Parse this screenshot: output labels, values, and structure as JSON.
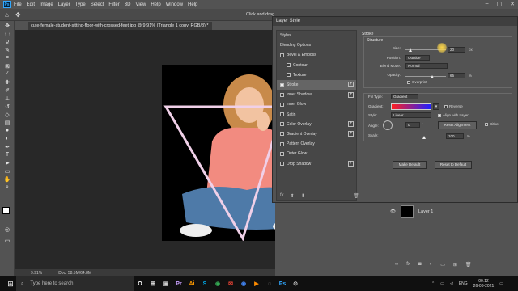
{
  "menubar": {
    "logo": "Ps",
    "items": [
      "File",
      "Edit",
      "Image",
      "Layer",
      "Type",
      "Select",
      "Filter",
      "3D",
      "View",
      "Help",
      "Window",
      "Help"
    ],
    "window_controls": [
      "–",
      "▢",
      "✕"
    ]
  },
  "optionsbar": {
    "hint": "Click and drag..."
  },
  "document": {
    "tab": "cute-female-student-sitting-floor-with-crossed-feet.jpg @ 9.91% (Triangle 1 copy, RGB/8) *",
    "zoom": "9.91%",
    "doc_info": "Doc: 58.5M/64.8M"
  },
  "dialog": {
    "title": "Layer Style",
    "styles_header": "Styles",
    "styles": [
      {
        "label": "Blending Options",
        "checkbox": false,
        "checked": false,
        "plus": false,
        "indent": false,
        "selected": false
      },
      {
        "label": "Bevel & Emboss",
        "checkbox": true,
        "checked": false,
        "plus": false,
        "indent": false,
        "selected": false
      },
      {
        "label": "Contour",
        "checkbox": true,
        "checked": false,
        "plus": false,
        "indent": true,
        "selected": false
      },
      {
        "label": "Texture",
        "checkbox": true,
        "checked": false,
        "plus": false,
        "indent": true,
        "selected": false
      },
      {
        "label": "Stroke",
        "checkbox": true,
        "checked": true,
        "plus": true,
        "indent": false,
        "selected": true
      },
      {
        "label": "Inner Shadow",
        "checkbox": true,
        "checked": false,
        "plus": true,
        "indent": false,
        "selected": false
      },
      {
        "label": "Inner Glow",
        "checkbox": true,
        "checked": false,
        "plus": false,
        "indent": false,
        "selected": false
      },
      {
        "label": "Satin",
        "checkbox": true,
        "checked": false,
        "plus": false,
        "indent": false,
        "selected": false
      },
      {
        "label": "Color Overlay",
        "checkbox": true,
        "checked": false,
        "plus": true,
        "indent": false,
        "selected": false
      },
      {
        "label": "Gradient Overlay",
        "checkbox": true,
        "checked": false,
        "plus": true,
        "indent": false,
        "selected": false
      },
      {
        "label": "Pattern Overlay",
        "checkbox": true,
        "checked": false,
        "plus": false,
        "indent": false,
        "selected": false
      },
      {
        "label": "Outer Glow",
        "checkbox": true,
        "checked": false,
        "plus": false,
        "indent": false,
        "selected": false
      },
      {
        "label": "Drop Shadow",
        "checkbox": true,
        "checked": false,
        "plus": true,
        "indent": false,
        "selected": false
      }
    ],
    "footer": {
      "fx": "fx",
      "up": "⬆",
      "down": "⬇",
      "trash": "🗑"
    },
    "stroke": {
      "heading": "Stroke",
      "structure": "Structure",
      "size_label": "Size:",
      "size_value": "20",
      "size_unit": "px",
      "position_label": "Position:",
      "position_value": "Outside",
      "blend_label": "Blend Mode:",
      "blend_value": "Normal",
      "opacity_label": "Opacity:",
      "opacity_value": "65",
      "opacity_unit": "%",
      "overprint": "Overprint",
      "fill_type_label": "Fill Type:",
      "fill_type_value": "Gradient",
      "gradient_label": "Gradient:",
      "reverse": "Reverse",
      "style_label": "Style:",
      "style_value": "Linear",
      "align": "Align with Layer",
      "angle_label": "Angle:",
      "angle_value": "0",
      "angle_unit": "°",
      "reset_alignment": "Reset Alignment",
      "dither": "Dither",
      "scale_label": "Scale:",
      "scale_value": "100",
      "scale_unit": "%"
    },
    "make_default": "Make Default",
    "reset_default": "Reset to Default",
    "colors": {
      "gradient_start": "#ff2020",
      "gradient_end": "#2020ff"
    }
  },
  "layers": {
    "layer1": "Layer 1",
    "footer_icons": [
      "link-icon",
      "fx-icon",
      "mask-icon",
      "adjust-icon",
      "folder-icon",
      "new-icon",
      "trash-icon"
    ]
  },
  "taskbar": {
    "search_placeholder": "Type here to search",
    "apps": [
      "O",
      "⊞",
      "▣",
      "Pr",
      "Ai",
      "S",
      "◉",
      "✉",
      "◉",
      "▶",
      "◌",
      "Ps",
      "⊙"
    ],
    "lang": "ENG",
    "time": "00:12",
    "date": "26-03-2021"
  }
}
